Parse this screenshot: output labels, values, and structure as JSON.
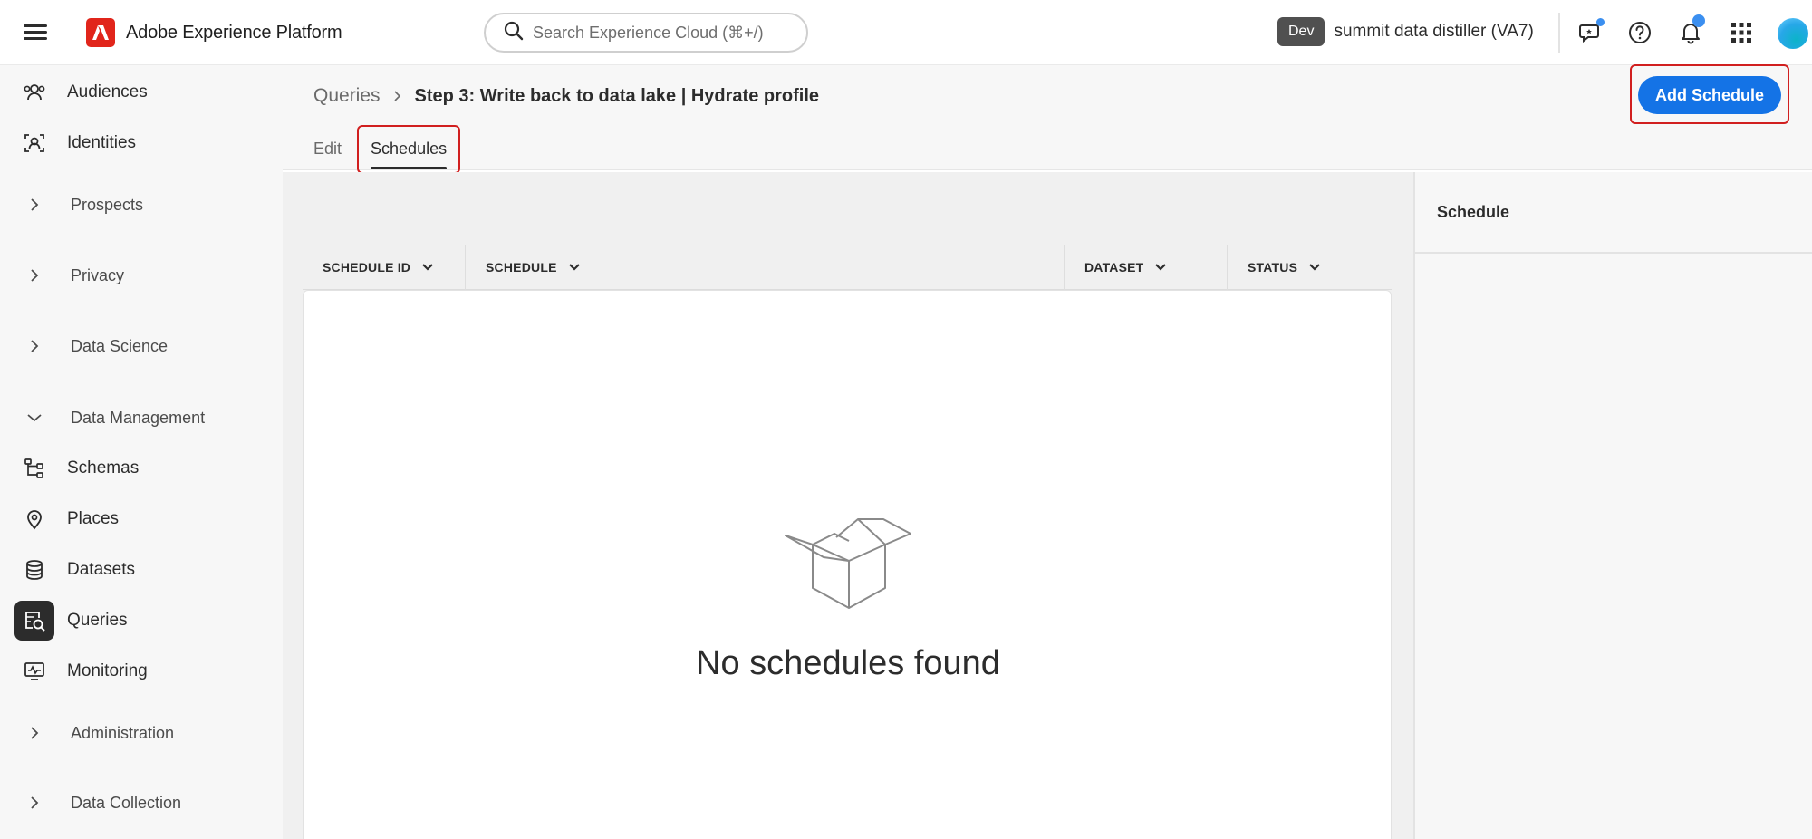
{
  "app": {
    "name": "Adobe Experience Platform",
    "logo_icon": "adobe-logo-icon",
    "brand_color": "#e1251b"
  },
  "search": {
    "placeholder": "Search Experience Cloud (⌘+/)"
  },
  "org": {
    "badge": "Dev",
    "name": "summit data distiller (VA7)"
  },
  "topbar_icons": [
    "feedback-icon",
    "help-icon",
    "notifications-icon",
    "apps-grid-icon",
    "avatar"
  ],
  "sidebar": {
    "items": [
      {
        "label": "Audiences",
        "icon": "audiences-icon",
        "type": "link"
      },
      {
        "label": "Identities",
        "icon": "identities-icon",
        "type": "link"
      },
      {
        "label": "Prospects",
        "icon": "chevron-right-icon",
        "type": "group",
        "expanded": false
      },
      {
        "label": "Privacy",
        "icon": "chevron-right-icon",
        "type": "group",
        "expanded": false
      },
      {
        "label": "Data Science",
        "icon": "chevron-right-icon",
        "type": "group",
        "expanded": false
      },
      {
        "label": "Data Management",
        "icon": "chevron-down-icon",
        "type": "group",
        "expanded": true
      },
      {
        "label": "Schemas",
        "icon": "schemas-icon",
        "type": "link"
      },
      {
        "label": "Places",
        "icon": "places-icon",
        "type": "link"
      },
      {
        "label": "Datasets",
        "icon": "datasets-icon",
        "type": "link"
      },
      {
        "label": "Queries",
        "icon": "queries-icon",
        "type": "link",
        "active": true
      },
      {
        "label": "Monitoring",
        "icon": "monitoring-icon",
        "type": "link"
      },
      {
        "label": "Administration",
        "icon": "chevron-right-icon",
        "type": "group",
        "expanded": false
      },
      {
        "label": "Data Collection",
        "icon": "chevron-right-icon",
        "type": "group",
        "expanded": false
      }
    ]
  },
  "breadcrumb": {
    "parent": "Queries",
    "current": "Step 3: Write back to data lake | Hydrate profile"
  },
  "tabs": [
    {
      "label": "Edit",
      "selected": false
    },
    {
      "label": "Schedules",
      "selected": true
    }
  ],
  "actions": {
    "add_schedule": "Add Schedule"
  },
  "table": {
    "columns": [
      "SCHEDULE ID",
      "SCHEDULE",
      "DATASET",
      "STATUS"
    ],
    "rows": []
  },
  "empty_state": {
    "illustration": "empty-box-icon",
    "message": "No schedules found"
  },
  "panel": {
    "title": "Schedule"
  },
  "colors": {
    "accent": "#1473e6",
    "highlight": "#d11f1f",
    "sidebar_bg": "#f7f7f7",
    "notification_dot": "#3b8ff0"
  }
}
